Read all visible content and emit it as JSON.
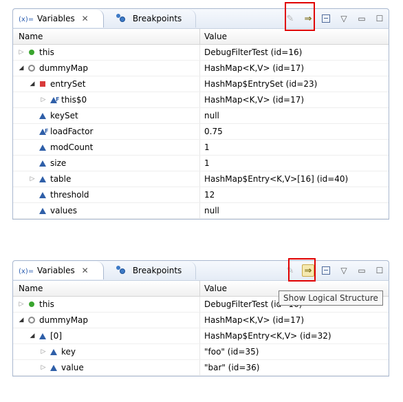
{
  "panels": [
    {
      "tabs": {
        "variables": "Variables",
        "breakpoints": "Breakpoints",
        "variables_prefix": "(x)="
      },
      "headers": {
        "name": "Name",
        "value": "Value"
      },
      "rows": [
        {
          "twisty": "closed",
          "icon": "field-green",
          "name": "this",
          "value": "DebugFilterTest  (id=16)",
          "depth": 0
        },
        {
          "twisty": "open",
          "icon": "field-gray",
          "name": "dummyMap",
          "value": "HashMap<K,V>  (id=17)",
          "depth": 0
        },
        {
          "twisty": "open",
          "icon": "field-red",
          "name": "entrySet",
          "value": "HashMap$EntrySet  (id=23)",
          "depth": 1
        },
        {
          "twisty": "closed",
          "icon": "field-blue final",
          "name": "this$0",
          "value": "HashMap<K,V>  (id=17)",
          "depth": 2
        },
        {
          "twisty": "none",
          "icon": "field-blue",
          "name": "keySet",
          "value": "null",
          "depth": 1
        },
        {
          "twisty": "none",
          "icon": "field-blue final",
          "name": "loadFactor",
          "value": "0.75",
          "depth": 1
        },
        {
          "twisty": "none",
          "icon": "field-blue",
          "name": "modCount",
          "value": "1",
          "depth": 1
        },
        {
          "twisty": "none",
          "icon": "field-blue",
          "name": "size",
          "value": "1",
          "depth": 1
        },
        {
          "twisty": "closed",
          "icon": "field-blue",
          "name": "table",
          "value": "HashMap$Entry<K,V>[16]  (id=40)",
          "depth": 1
        },
        {
          "twisty": "none",
          "icon": "field-blue",
          "name": "threshold",
          "value": "12",
          "depth": 1
        },
        {
          "twisty": "none",
          "icon": "field-blue",
          "name": "values",
          "value": "null",
          "depth": 1
        }
      ]
    },
    {
      "tabs": {
        "variables": "Variables",
        "breakpoints": "Breakpoints",
        "variables_prefix": "(x)="
      },
      "headers": {
        "name": "Name",
        "value": "Value"
      },
      "tooltip": "Show Logical Structure",
      "rows": [
        {
          "twisty": "closed",
          "icon": "field-green",
          "name": "this",
          "value": "DebugFilterTest  (id=16)",
          "depth": 0
        },
        {
          "twisty": "open",
          "icon": "field-gray",
          "name": "dummyMap",
          "value": "HashMap<K,V>  (id=17)",
          "depth": 0
        },
        {
          "twisty": "open",
          "icon": "field-blue",
          "name": "[0]",
          "value": "HashMap$Entry<K,V>  (id=32)",
          "depth": 1
        },
        {
          "twisty": "closed",
          "icon": "field-blue",
          "name": "key",
          "value": "\"foo\" (id=35)",
          "depth": 2
        },
        {
          "twisty": "closed",
          "icon": "field-blue",
          "name": "value",
          "value": "\"bar\" (id=36)",
          "depth": 2
        }
      ]
    }
  ],
  "icons": {
    "close": "close-icon",
    "collapse_all": "collapse-all-icon",
    "show_type_names": "show-type-names-icon",
    "show_logical_structure": "show-logical-structure-icon",
    "view_menu": "view-menu-icon",
    "minimize": "minimize-icon",
    "maximize": "maximize-icon"
  },
  "colors": {
    "highlight": "#e00000",
    "tab_border": "#a9b8cf"
  }
}
